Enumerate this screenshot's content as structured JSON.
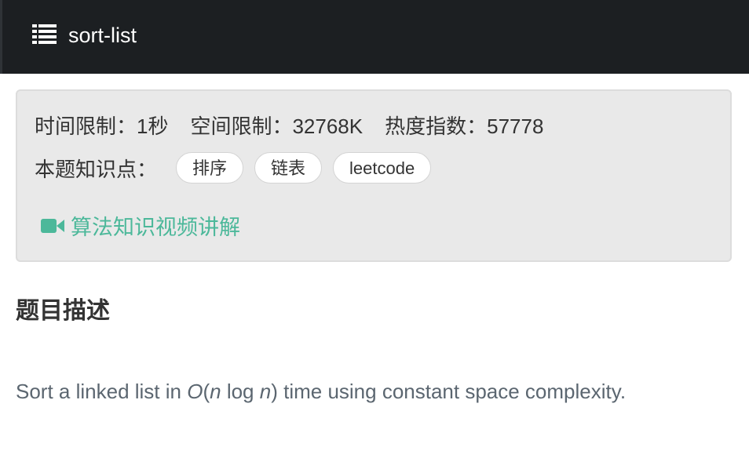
{
  "header": {
    "icon": "list-icon",
    "title": "sort-list"
  },
  "info": {
    "time_limit": "时间限制：1秒",
    "space_limit": "空间限制：32768K",
    "heat_index": "热度指数：57778",
    "tags_label": "本题知识点：",
    "tags": [
      "排序",
      "链表",
      "leetcode"
    ],
    "video_link": "算法知识视频讲解",
    "video_icon": "video-camera-icon",
    "accent_color": "#4cb89a"
  },
  "section": {
    "title": "题目描述"
  },
  "description": {
    "prefix": "Sort a linked list in ",
    "o": "O",
    "open_paren": "(",
    "n1": "n",
    "log": " log ",
    "n2": "n",
    "suffix": ") time using constant space complexity."
  }
}
